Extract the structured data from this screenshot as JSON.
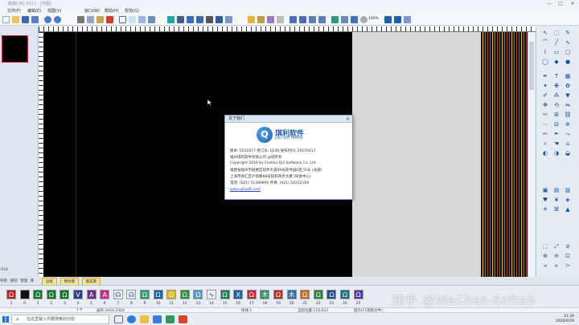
{
  "window": {
    "title": "服装CAD 2017 - [作图]"
  },
  "menu": {
    "items": [
      "文件(F)",
      "编辑(E)",
      "视图(V)",
      "窗口(W)",
      "帮助(H)",
      "规范(G)"
    ]
  },
  "toolbar": {
    "zoom_value": "100%"
  },
  "left_panel": {
    "bottom_label": "034"
  },
  "left_tabs": [
    "导航",
    "缝纫",
    "管理",
    "库"
  ],
  "bottom_tabs": [
    "边框",
    "绣纹图",
    "图案库"
  ],
  "about_dialog": {
    "title": "关于我们",
    "brand_cn": "琪利软件",
    "brand_en": "QILI SOFTWARE",
    "logo_letter": "Q",
    "lines": [
      "版本: EE02017        修订号: 0236       发布时间: 20170417",
      "福州琪利软件有限公司               @权所有",
      "Copyright 2016 by Fuzhou Qili Software Co.,Ltd.",
      "福建省福州市鼓楼区软件大道89号软件园D区35号 (总部)",
      "上海市徐汇区沪闵路88号纺织商务大厦 (研发中心)",
      "电话: (021) 51489890    传真: (021) 54252169"
    ],
    "website": "www.qilisoft.com"
  },
  "color_swatches": {
    "items": [
      {
        "num": "1",
        "color": "#b3201f",
        "glyph": "Ω"
      },
      {
        "num": "0",
        "color": "#111111",
        "glyph": ""
      },
      {
        "num": "1",
        "color": "#0d7a2a",
        "glyph": "Ω"
      },
      {
        "num": "2",
        "color": "#0d7a2a",
        "glyph": "Ω"
      },
      {
        "num": "3",
        "color": "#0d7a2a",
        "glyph": "Ω"
      },
      {
        "num": "4",
        "color": "#2c3e8f",
        "glyph": "V"
      },
      {
        "num": "5",
        "color": "#6d2a8a",
        "glyph": "A"
      },
      {
        "num": "6",
        "color": "#c22f86",
        "glyph": "A"
      },
      {
        "num": "7",
        "color": "#e9eef2",
        "glyph": "☊"
      },
      {
        "num": "8",
        "color": "#e9eef2",
        "glyph": "☊"
      },
      {
        "num": "9",
        "color": "#2a9d6e",
        "glyph": "Ω"
      },
      {
        "num": "10",
        "color": "#1f5fa8",
        "glyph": "Ω"
      },
      {
        "num": "11",
        "color": "#d9b21d",
        "glyph": "Ω"
      },
      {
        "num": "12",
        "color": "#2e8c3a",
        "glyph": "Ω"
      },
      {
        "num": "13",
        "color": "#4c9bd3",
        "glyph": "Ω"
      },
      {
        "num": "14",
        "color": "#e9eef2",
        "glyph": "∿"
      },
      {
        "num": "15",
        "color": "#1e7d52",
        "glyph": "Ω"
      },
      {
        "num": "16",
        "color": "#2a5fa6",
        "glyph": "X"
      },
      {
        "num": "17",
        "color": "#c5273a",
        "glyph": "Ω"
      },
      {
        "num": "18",
        "color": "#3a8f62",
        "glyph": "木"
      },
      {
        "num": "19",
        "color": "#b33128",
        "glyph": "Ω"
      },
      {
        "num": "20",
        "color": "#2f6f9f",
        "glyph": "木"
      },
      {
        "num": "21",
        "color": "#c76a23",
        "glyph": "Ω"
      },
      {
        "num": "22",
        "color": "#2c7f3c",
        "glyph": "Ω"
      },
      {
        "num": "23",
        "color": "#234a8e",
        "glyph": "Ω"
      },
      {
        "num": "24",
        "color": "#1d6a7c",
        "glyph": "Ω"
      },
      {
        "num": "25",
        "color": "#4c3b9a",
        "glyph": "Ω"
      }
    ]
  },
  "status": {
    "pos": "1 X",
    "size": "画布:1024,1024",
    "mode": "绘线  1",
    "coords": "当前位置:119,622",
    "hint": "提示(F1帮助文件)"
  },
  "taskbar": {
    "search_placeholder": "在这里输入你要搜索的内容",
    "time": "21:39",
    "date": "2020/6/29"
  },
  "watermark": "知乎 @WeChat-6oftab"
}
